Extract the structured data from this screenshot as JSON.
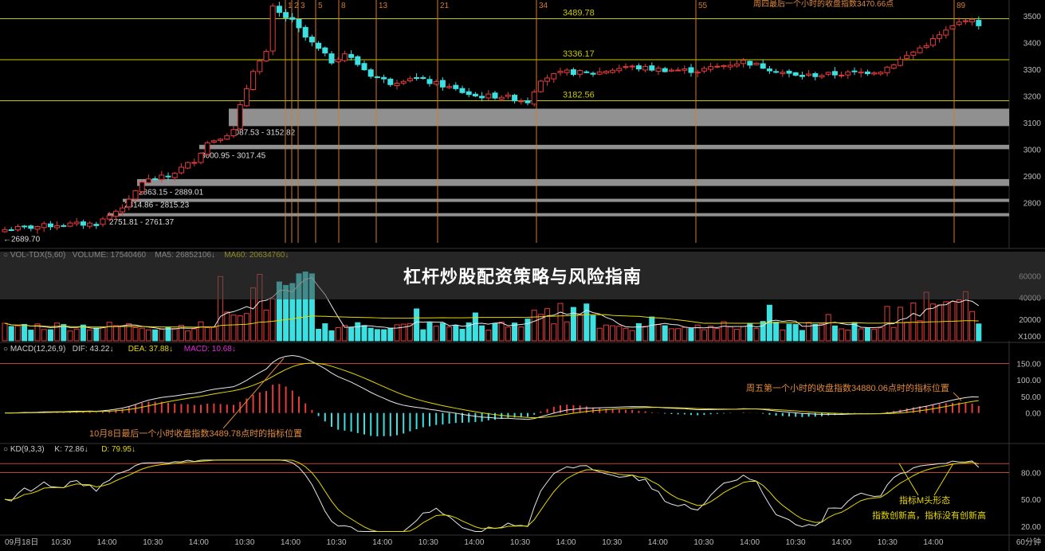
{
  "article_title": "杠杆炒股配资策略与风险指南",
  "colors": {
    "up": "#e83b3b",
    "down": "#3de0e0",
    "ma_white": "#e8e8e8",
    "ma_yellow": "#e6d800",
    "level": "#c8c800",
    "vline": "#d37a2a",
    "zone": "#a0a0a0",
    "annot": "#e08a3a",
    "red_line": "#c0462b",
    "magenta": "#e02ad8"
  },
  "chart_data": {
    "type": "candlestick",
    "title": "",
    "price_axis": {
      "ylim": [
        2650,
        3560
      ],
      "ticks": [
        3500,
        3400,
        3300,
        3200,
        3100,
        3000,
        2900,
        2800
      ]
    },
    "candles": [],
    "levels": [
      {
        "value": 3489.78,
        "label": "3489.78"
      },
      {
        "value": 3336.17,
        "label": "3336.17"
      },
      {
        "value": 3182.56,
        "label": "3182.56"
      }
    ],
    "support_zones": [
      {
        "low": 3087.53,
        "high": 3152.82,
        "label": "3087.53 - 3152.82",
        "x_label": 287
      },
      {
        "low": 3000.95,
        "high": 3017.45,
        "label": "3000.95 - 3017.45",
        "x_label": 250
      },
      {
        "low": 2863.15,
        "high": 2889.01,
        "label": "2863.15 - 2889.01",
        "x_label": 172
      },
      {
        "low": 2814.86,
        "high": 2815.23,
        "label": "2814.86 - 2815.23",
        "x_label": 154
      },
      {
        "low": 2751.81,
        "high": 2761.37,
        "label": "2751.81 - 2761.37",
        "x_label": 135
      }
    ],
    "low_label": "2689.70",
    "fib_lines": [
      {
        "label": "1",
        "x": 358
      },
      {
        "label": "2",
        "x": 366
      },
      {
        "label": "3",
        "x": 374
      },
      {
        "label": "5",
        "x": 396
      },
      {
        "label": "8",
        "x": 425
      },
      {
        "label": "13",
        "x": 472
      },
      {
        "label": "21",
        "x": 549
      },
      {
        "label": "34",
        "x": 673
      },
      {
        "label": "55",
        "x": 873
      },
      {
        "label": "89",
        "x": 1197
      }
    ],
    "price_annotation": "周四最后一个小时的收盘指数3470.66点",
    "volume": {
      "header": {
        "title": "VOL-TDX(5,60)",
        "volume": "VOLUME: 17540460",
        "ma5": "MA5: 26852106",
        "ma60": "MA60: 20634760"
      },
      "ticks": [
        60000,
        40000,
        20000
      ],
      "unit": "X1000",
      "ylim": [
        0,
        75000
      ],
      "values": []
    },
    "macd": {
      "header": {
        "title": "MACD(12,26,9)",
        "dif": "DIF: 43.22",
        "dea": "DEA: 37.88",
        "macd": "MACD: 10.68"
      },
      "ticks": [
        150,
        100,
        50,
        0
      ],
      "ylim": [
        -90,
        180
      ],
      "annotation_left": "10月8日最后一个小时收盘指数3489.78点时的指标位置",
      "annotation_right": "周五第一个小时的收盘指数34880.06点时的指标位置"
    },
    "kd": {
      "header": {
        "title": "KD(9,3,3)",
        "k": "K: 72.86",
        "d": "D: 79.95"
      },
      "ticks": [
        80,
        50,
        20
      ],
      "ylim": [
        10,
        100
      ],
      "red_lines": [
        90,
        80
      ],
      "annotation": [
        "指标M头形态",
        "指数创新高，指标没有创新高"
      ]
    },
    "x_axis": {
      "labels": [
        "09月18日",
        "10:30",
        "14:00",
        "10:30",
        "14:00",
        "10:30",
        "14:00",
        "10:30",
        "14:00",
        "10:30",
        "14:00",
        "10:30",
        "14:00",
        "10:30",
        "14:00",
        "10:30",
        "14:00",
        "10:30",
        "14:00",
        "10:30",
        "14:00"
      ],
      "period": "60分钟"
    }
  }
}
